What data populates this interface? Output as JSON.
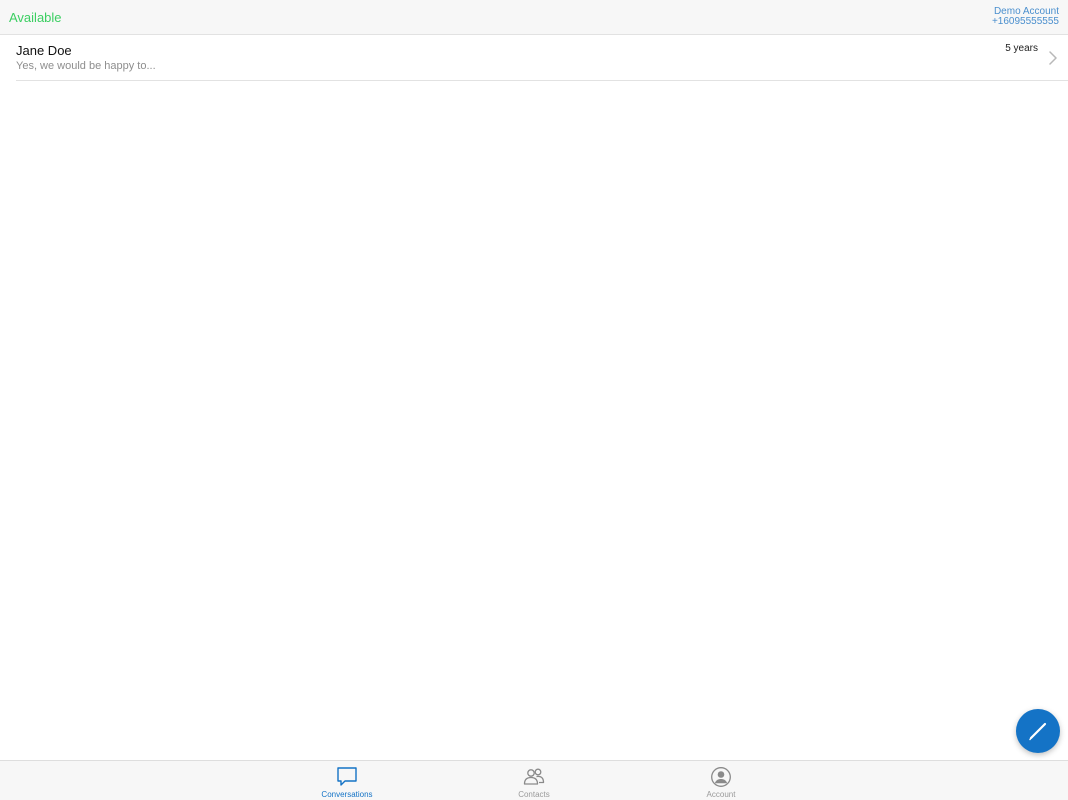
{
  "colors": {
    "status_available": "#3ccf62",
    "accent": "#1473c6",
    "account_text": "#4a8fce",
    "inactive_tab": "#9a9a9a"
  },
  "header": {
    "status": "Available",
    "account_name": "Demo Account",
    "account_number": "+16095555555"
  },
  "conversations": [
    {
      "name": "Jane Doe",
      "preview": "Yes, we would be happy to...",
      "time": "5 years"
    }
  ],
  "fab": {
    "icon": "compose-pencil-icon"
  },
  "tabs": [
    {
      "label": "Conversations",
      "icon": "chat-bubble-icon",
      "active": true
    },
    {
      "label": "Contacts",
      "icon": "people-icon",
      "active": false
    },
    {
      "label": "Account",
      "icon": "account-circle-icon",
      "active": false
    }
  ]
}
